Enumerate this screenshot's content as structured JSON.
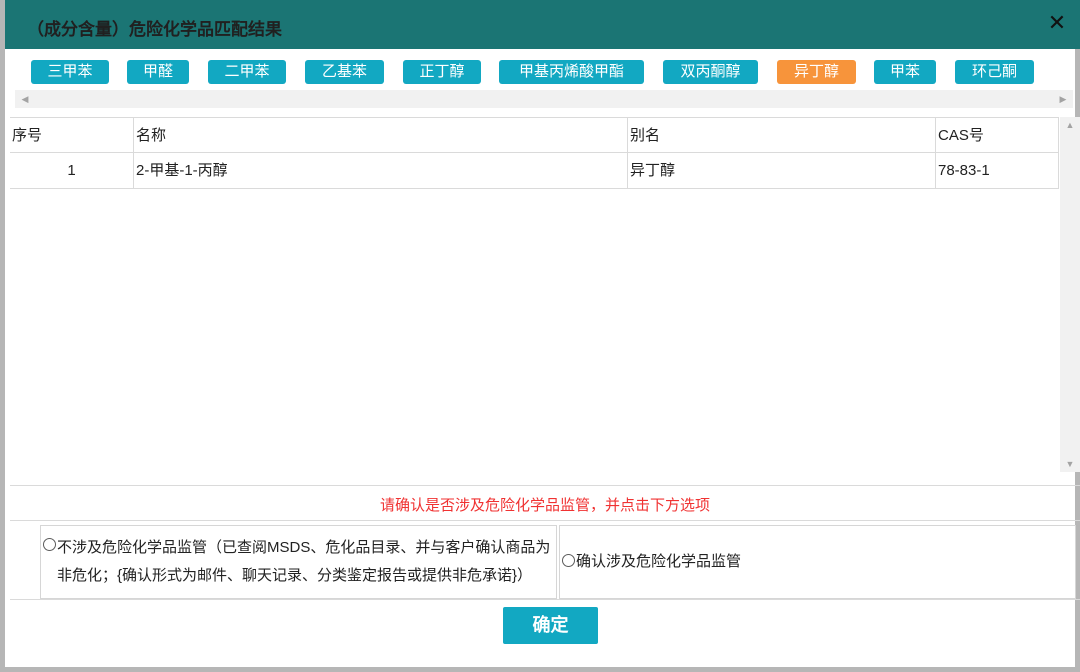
{
  "dialog": {
    "title": "（成分含量）危险化学品匹配结果",
    "close_glyph": "✕"
  },
  "chips": [
    {
      "label": "三甲苯",
      "active": false
    },
    {
      "label": "甲醛",
      "active": false
    },
    {
      "label": "二甲苯",
      "active": false
    },
    {
      "label": "乙基苯",
      "active": false
    },
    {
      "label": "正丁醇",
      "active": false
    },
    {
      "label": "甲基丙烯酸甲酯",
      "active": false
    },
    {
      "label": "双丙酮醇",
      "active": false
    },
    {
      "label": "异丁醇",
      "active": true
    },
    {
      "label": "甲苯",
      "active": false
    },
    {
      "label": "环己酮",
      "active": false
    }
  ],
  "colors": {
    "titlebar": "#1b7574",
    "chip": "#12a8c2",
    "chip_active": "#f7943b",
    "notice": "#f03232",
    "ok_button": "#12a8c2"
  },
  "table": {
    "headers": [
      "序号",
      "名称",
      "别名",
      "CAS号"
    ],
    "rows": [
      [
        "1",
        "2-甲基-1-丙醇",
        "异丁醇",
        "78-83-1"
      ]
    ]
  },
  "notice": "请确认是否涉及危险化学品监管，并点击下方选项",
  "options": {
    "not_regulated": "不涉及危险化学品监管（已查阅MSDS、危化品目录、并与客户确认商品为非危化；{确认形式为邮件、聊天记录、分类鉴定报告或提供非危承诺}）",
    "regulated": "确认涉及危险化学品监管"
  },
  "buttons": {
    "ok": "确定"
  },
  "icons": {
    "scroll_left": "◀",
    "scroll_right": "▶",
    "scroll_up": "▲",
    "scroll_down": "▼"
  }
}
